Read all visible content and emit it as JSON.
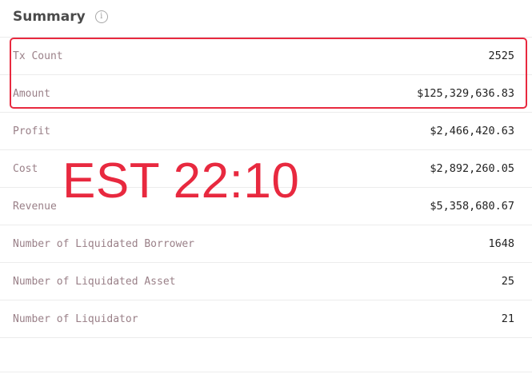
{
  "summary": {
    "title": "Summary",
    "info_icon": "info-icon",
    "rows": [
      {
        "label": "Tx Count",
        "value": "2525"
      },
      {
        "label": "Amount",
        "value": "$125,329,636.83"
      },
      {
        "label": "Profit",
        "value": "$2,466,420.63"
      },
      {
        "label": "Cost",
        "value": "$2,892,260.05"
      },
      {
        "label": "Revenue",
        "value": "$5,358,680.67"
      },
      {
        "label": "Number of Liquidated Borrower",
        "value": "1648"
      },
      {
        "label": "Number of Liquidated Asset",
        "value": "25"
      },
      {
        "label": "Number of Liquidator",
        "value": "21"
      }
    ]
  },
  "annotation": {
    "overlay_text": "EST 22:10",
    "color": "#e8293f"
  }
}
